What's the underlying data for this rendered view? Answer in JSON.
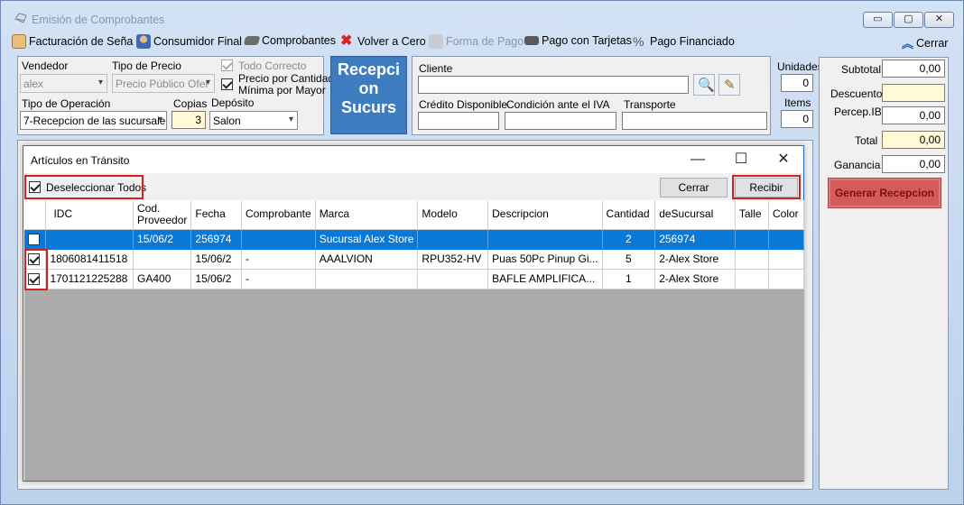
{
  "window": {
    "title": "Emisión de Comprobantes",
    "controls": [
      "▭",
      "▢",
      "✕"
    ]
  },
  "toolbar": {
    "items": [
      {
        "label": "Facturación de Seña",
        "icon": "receipt-icon"
      },
      {
        "label": "Consumidor Final",
        "icon": "person-icon"
      },
      {
        "label": "Comprobantes",
        "icon": "handshake-icon"
      },
      {
        "label": "Volver a Cero",
        "icon": "red-x-icon"
      },
      {
        "label": "Forma de Pago",
        "icon": "money-icon",
        "disabled": true
      },
      {
        "label": "Pago con Tarjetas",
        "icon": "card-icon"
      },
      {
        "label": "Pago Financiado",
        "icon": "chart-icon"
      }
    ],
    "close_label": "Cerrar"
  },
  "form": {
    "vendedor_label": "Vendedor",
    "vendedor_value": "alex",
    "tipo_precio_label": "Tipo de Precio",
    "tipo_precio_value": "Precio Público Ofer",
    "todo_correcto_label": "Todo Correcto",
    "precio_cantidad_label": "Precio por Cantidad",
    "minima_mayor_label": "Mínima por Mayor",
    "tipo_operacion_label": "Tipo de Operación",
    "tipo_operacion_value": "7-Recepcion de las sucursale",
    "copias_label": "Copias",
    "copias_value": "3",
    "deposito_label": "Depósito",
    "deposito_value": "Salon",
    "big_button_label": "Recepcion Sucurs",
    "big_button_lines": [
      "Recepci",
      "on",
      "Sucurs"
    ],
    "cliente_label": "Cliente",
    "cliente_value": "",
    "credito_label": "Crédito Disponible",
    "condicion_iva_label": "Condición ante el IVA",
    "transporte_label": "Transporte",
    "unidades_label": "Unidades",
    "unidades_value": "0",
    "items_label": "Items",
    "items_value": "0"
  },
  "totals": {
    "subtotal_label": "Subtotal",
    "subtotal_value": "0,00",
    "descuento_label": "Descuento",
    "descuento_value": "",
    "percep_label": "Percep.IB",
    "percep_value": "0,00",
    "total_label": "Total",
    "total_value": "0,00",
    "ganancia_label": "Ganancia",
    "ganancia_value": "0,00",
    "generar_label": "Generar Recepcion"
  },
  "dialog": {
    "title": "Artículos en Tránsito",
    "deselect_label": "Deseleccionar Todos",
    "cerrar_label": "Cerrar",
    "recibir_label": "Recibir",
    "columns": [
      "",
      "IDC",
      "Cod.\nProveedor",
      "Fecha",
      "Comprobante",
      "Marca",
      "Modelo",
      "Descripcion",
      "Cantidad",
      "deSucursal",
      "Talle",
      "Color"
    ],
    "rows": [
      {
        "checked": false,
        "selected": true,
        "cells": [
          "",
          "15/06/2",
          "256974",
          "",
          "Sucursal Alex Store",
          "",
          "",
          "2",
          "256974",
          "",
          ""
        ]
      },
      {
        "checked": true,
        "selected": false,
        "cells": [
          "1806081411518",
          "",
          "15/06/2",
          "-",
          "AAALVION",
          "RPU352-HV",
          "Puas 50Pc Pinup Gi...",
          "5",
          "2-Alex Store",
          "",
          ""
        ]
      },
      {
        "checked": true,
        "selected": false,
        "cells": [
          "1701121225288",
          "GA400",
          "15/06/2",
          "-",
          "",
          "",
          "BAFLE AMPLIFICA...",
          "1",
          "2-Alex Store",
          "",
          ""
        ]
      }
    ]
  }
}
